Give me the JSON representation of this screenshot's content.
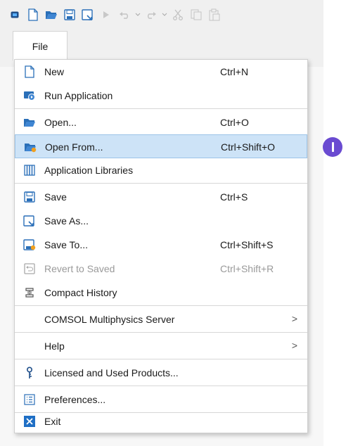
{
  "file_tab": "File",
  "toolbar": {
    "icons": [
      "app-icon",
      "new-icon",
      "open-icon",
      "save-icon",
      "save-as-icon",
      "run-icon",
      "undo-icon",
      "redo-icon",
      "cut-icon",
      "copy-icon",
      "paste-icon"
    ]
  },
  "menu": {
    "new": {
      "label": "New",
      "shortcut": "Ctrl+N"
    },
    "run_application": {
      "label": "Run Application"
    },
    "open": {
      "label": "Open...",
      "shortcut": "Ctrl+O"
    },
    "open_from": {
      "label": "Open From...",
      "shortcut": "Ctrl+Shift+O"
    },
    "application_libraries": {
      "label": "Application Libraries"
    },
    "save": {
      "label": "Save",
      "shortcut": "Ctrl+S"
    },
    "save_as": {
      "label": "Save As..."
    },
    "save_to": {
      "label": "Save To...",
      "shortcut": "Ctrl+Shift+S"
    },
    "revert": {
      "label": "Revert to Saved",
      "shortcut": "Ctrl+Shift+R"
    },
    "compact_history": {
      "label": "Compact History"
    },
    "comsol_server": {
      "label": "COMSOL Multiphysics Server",
      "arrow": ">"
    },
    "help": {
      "label": "Help",
      "arrow": ">"
    },
    "licensed_products": {
      "label": "Licensed and Used Products..."
    },
    "preferences": {
      "label": "Preferences..."
    },
    "exit": {
      "label": "Exit"
    }
  },
  "colors": {
    "highlight": "#cde3f7",
    "accent": "#1f6fc5",
    "badge": "#6a4bd1"
  }
}
